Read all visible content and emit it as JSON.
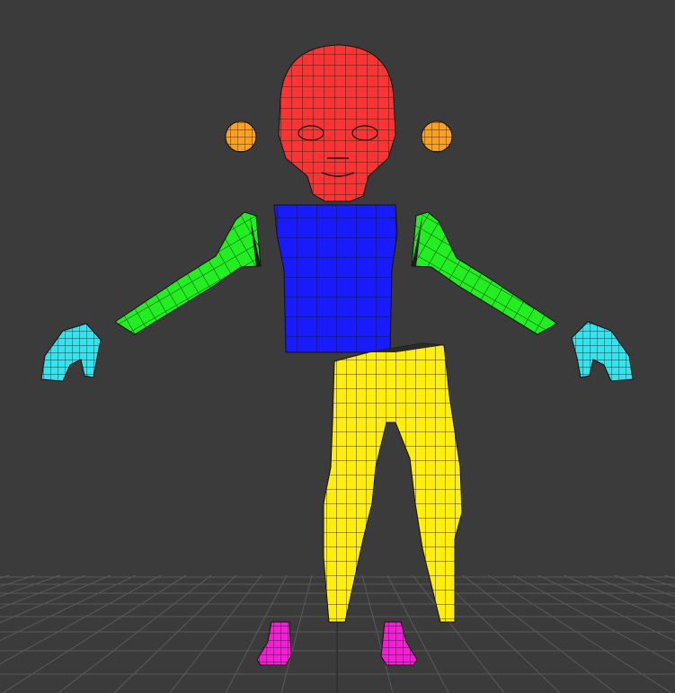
{
  "viewport": {
    "background": "#3b3b3b",
    "grid_color": "#5a5a5a",
    "grid_axis_color": "#2e2e2e"
  },
  "model": {
    "parts": [
      {
        "name": "head",
        "color": "#ff3333"
      },
      {
        "name": "left-eye",
        "color": "#ff9f1a"
      },
      {
        "name": "right-eye",
        "color": "#ff9f1a"
      },
      {
        "name": "torso",
        "color": "#1a1aff"
      },
      {
        "name": "left-arm",
        "color": "#22ee22"
      },
      {
        "name": "right-arm",
        "color": "#22ee22"
      },
      {
        "name": "left-hand",
        "color": "#2ee6f0"
      },
      {
        "name": "right-hand",
        "color": "#2ee6f0"
      },
      {
        "name": "legs",
        "color": "#ffee10"
      },
      {
        "name": "left-foot",
        "color": "#ff1ad9"
      },
      {
        "name": "right-foot",
        "color": "#ff1ad9"
      }
    ],
    "wire_color": "#111111"
  }
}
